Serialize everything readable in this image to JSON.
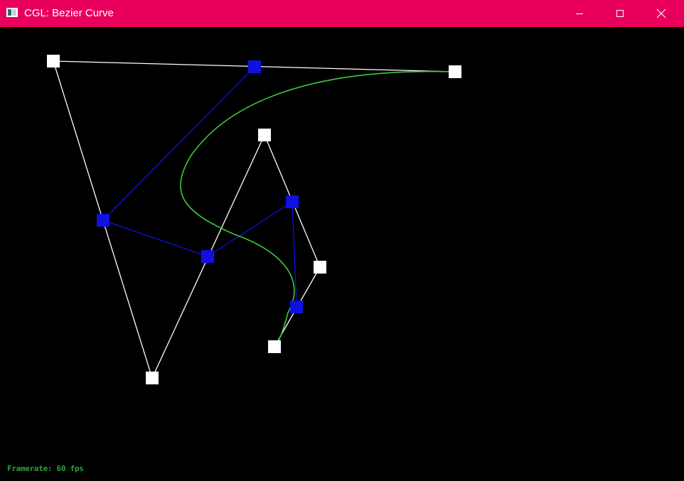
{
  "window": {
    "title": "CGL: Bezier Curve",
    "titlebar_color": "#e9005c",
    "icons": {
      "app": "app-window-icon",
      "minimize": "minimize-icon",
      "maximize": "maximize-icon",
      "close": "close-icon"
    }
  },
  "colors": {
    "background": "#000000",
    "control_polygon": "#ffffff",
    "intermediate_polygon": "#1010e0",
    "curve": "#3ec93e",
    "framerate_text": "#2fa13a"
  },
  "status": {
    "framerate": "Framerate: 60 fps"
  }
}
